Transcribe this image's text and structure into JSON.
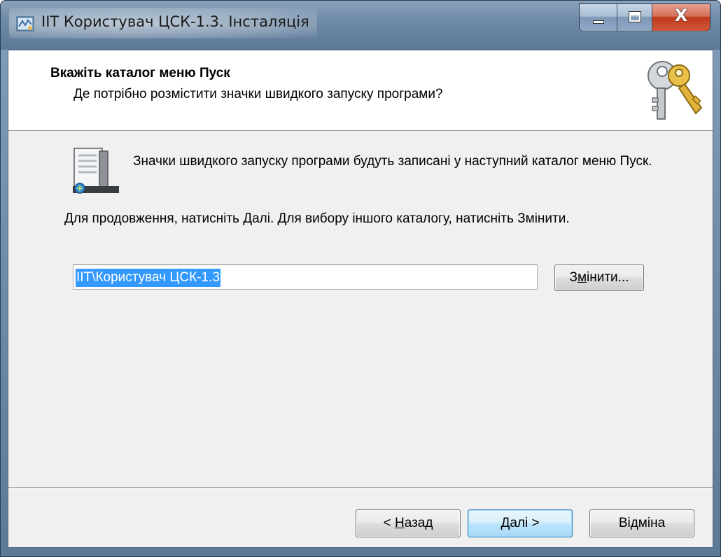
{
  "window": {
    "title": "ІІТ Користувач ЦСК-1.3. Інсталяція",
    "controls": [
      "minimize-icon",
      "maximize-icon",
      "close-icon"
    ],
    "close_glyph": "X"
  },
  "header": {
    "title": "Вкажіть каталог меню Пуск",
    "subtitle": "Де потрібно розмістити значки швидкого запуску програми?",
    "icon": "keys-icon"
  },
  "content": {
    "icon": "start-menu-folder-icon",
    "info_text": "Значки швидкого запуску програми будуть записані у наступний каталог меню Пуск.",
    "instruction_text": "Для продовження, натисніть Далі. Для вибору іншого каталогу, натисніть Змінити.",
    "folder_value": "ІІТ\\Користувач ЦСК-1.3",
    "change_button": {
      "pre": "З",
      "accel": "м",
      "post": "інити..."
    }
  },
  "footer": {
    "back_button": {
      "pre": "< ",
      "accel": "Н",
      "post": "азад"
    },
    "next_button": {
      "pre": "",
      "accel": "Д",
      "post": "алі >"
    },
    "cancel_button": "Відміна"
  },
  "colors": {
    "selection": "#3399ff",
    "dialog_bg": "#f0f0f0",
    "close_button": "#c1391c"
  }
}
